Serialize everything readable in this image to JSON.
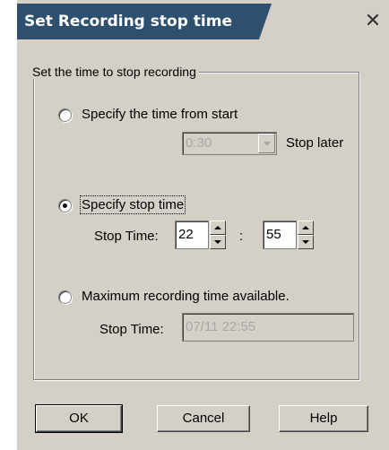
{
  "window": {
    "title": "Set Recording stop time",
    "close_glyph": "✕"
  },
  "group": {
    "legend": "Set the time to stop recording"
  },
  "option_from_start": {
    "label": "Specify the time from start",
    "selected": false,
    "duration_value": "0:30",
    "suffix_label": "Stop later"
  },
  "option_stop_time": {
    "label": "Specify stop time",
    "selected": true,
    "stop_time_label": "Stop Time:",
    "hour_value": "22",
    "separator": ":",
    "minute_value": "55"
  },
  "option_maximum": {
    "label": "Maximum recording time available.",
    "selected": false,
    "stop_time_label": "Stop Time:",
    "stop_time_value": "07/11 22:55"
  },
  "buttons": {
    "ok": "OK",
    "cancel": "Cancel",
    "help": "Help"
  },
  "colors": {
    "title_bg": "#2f4f6f",
    "dialog_bg": "#d4d0c8",
    "disabled_text": "#a8a8a8"
  }
}
